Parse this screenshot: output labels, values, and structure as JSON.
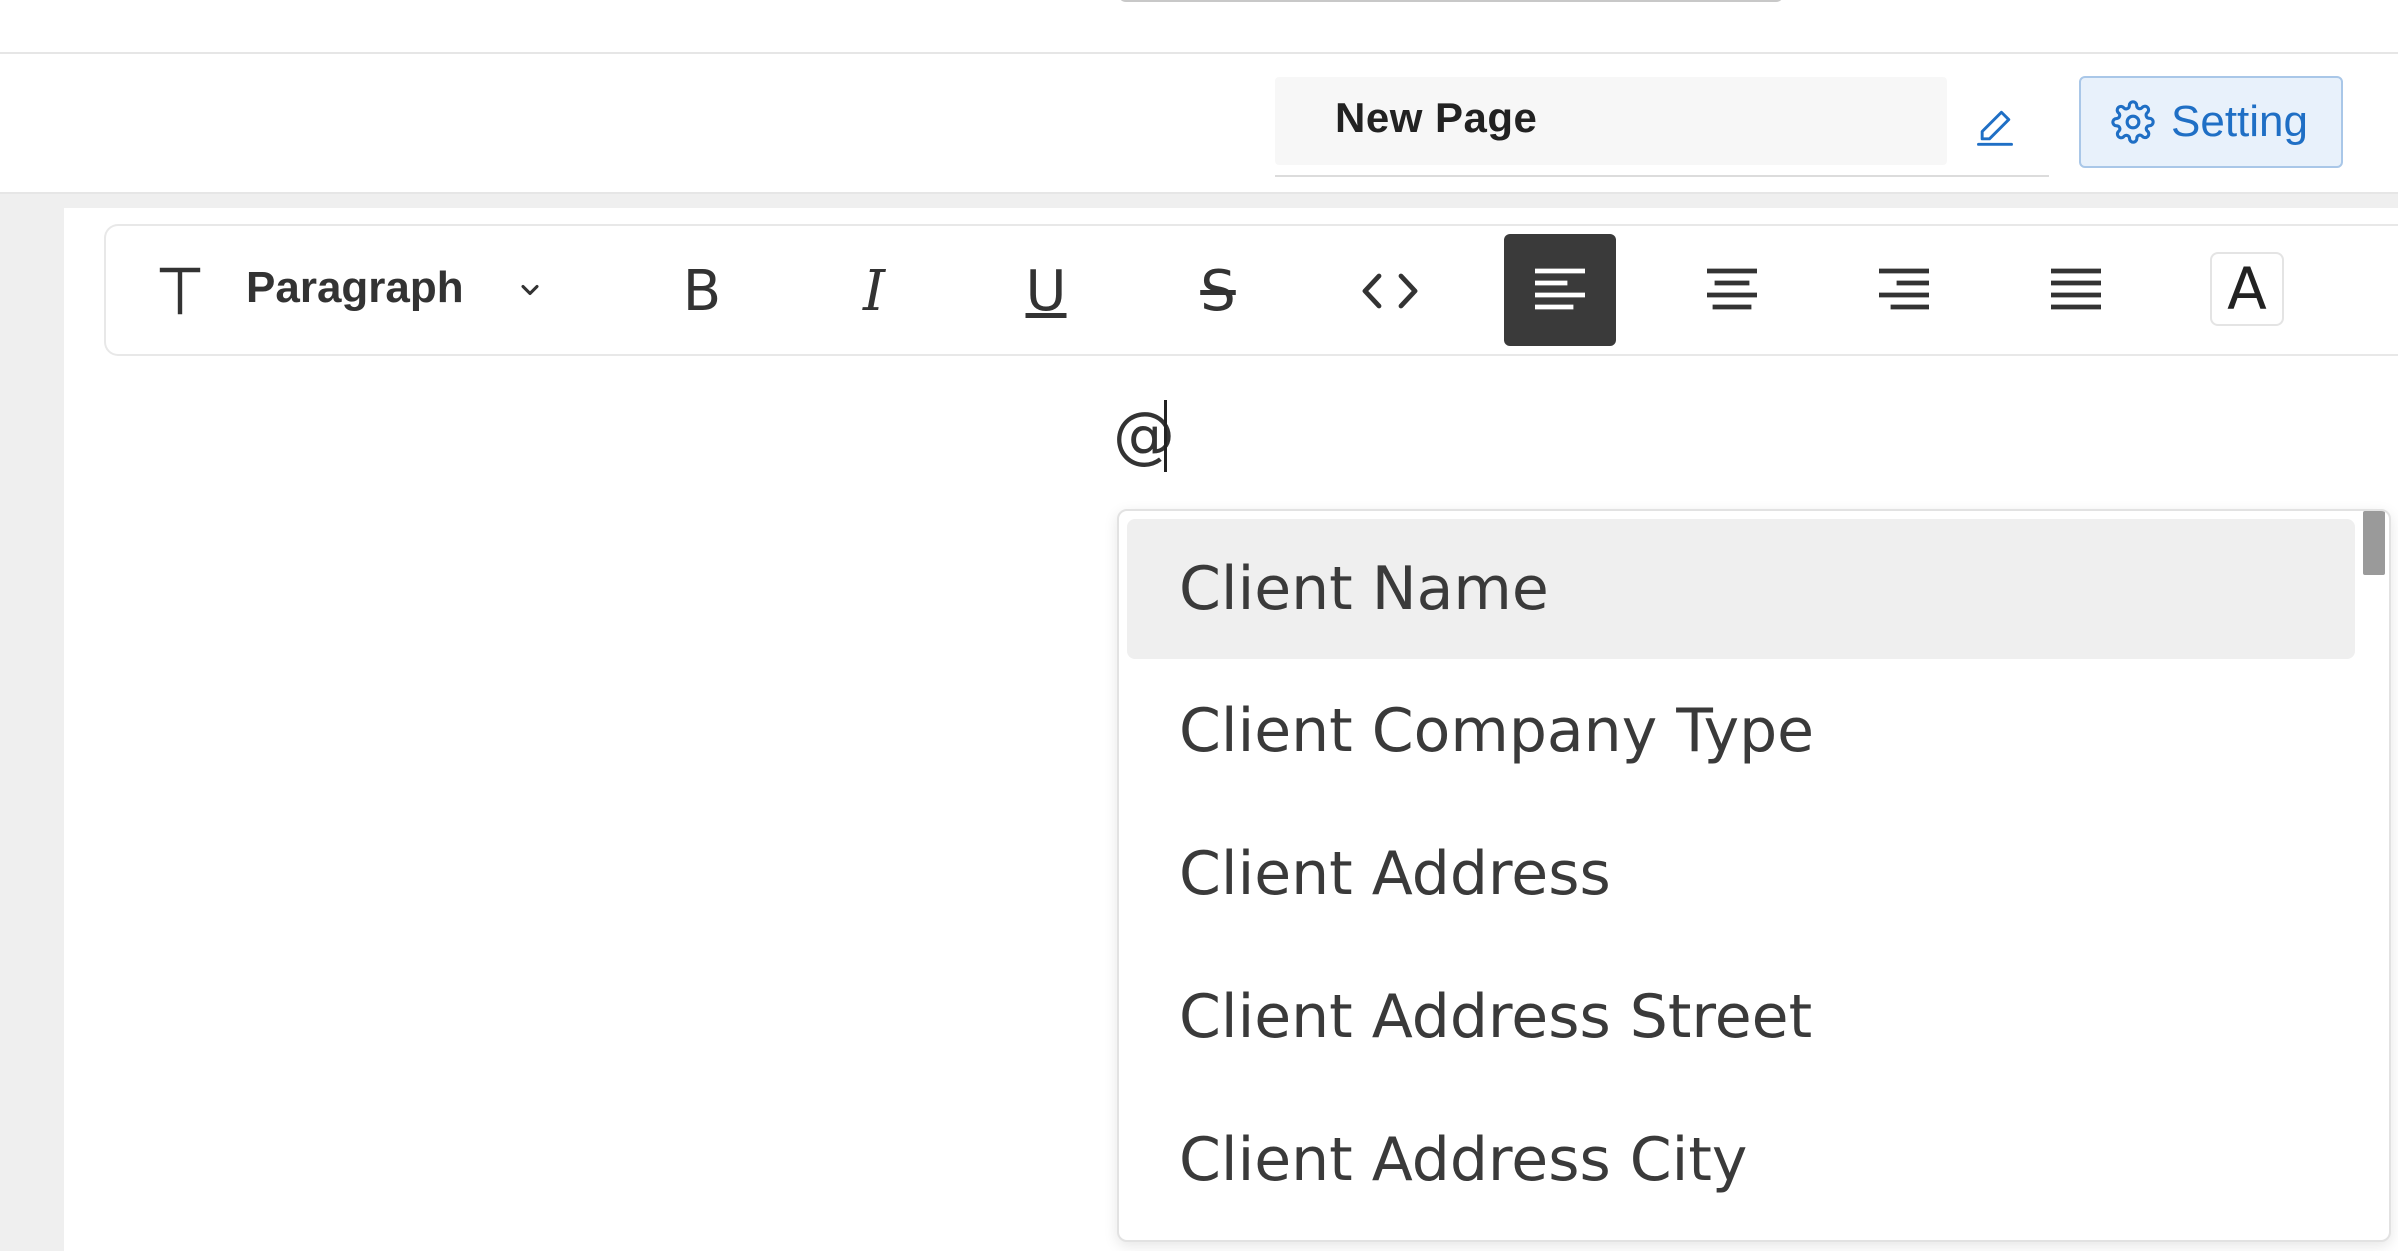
{
  "header": {
    "page_title": "New Page",
    "setting_label": "Setting",
    "colors": {
      "accent": "#1f6fc5",
      "setting_bg": "#e8f1fb"
    }
  },
  "toolbar": {
    "block_type_icon": "text-type-icon",
    "block_type_label": "Paragraph",
    "buttons": [
      {
        "name": "bold",
        "glyph": "B"
      },
      {
        "name": "italic",
        "glyph": "I"
      },
      {
        "name": "underline",
        "glyph": "U"
      },
      {
        "name": "strikethrough",
        "glyph": "S"
      },
      {
        "name": "code",
        "glyph": "<>"
      },
      {
        "name": "align-left",
        "glyph": "align-left-icon",
        "active": true
      },
      {
        "name": "align-center",
        "glyph": "align-center-icon"
      },
      {
        "name": "align-right",
        "glyph": "align-right-icon"
      },
      {
        "name": "align-justify",
        "glyph": "align-justify-icon"
      },
      {
        "name": "font-color",
        "glyph": "A"
      }
    ]
  },
  "editor": {
    "typed_text": "@"
  },
  "mention_menu": {
    "items": [
      {
        "label": "Client Name",
        "highlighted": true
      },
      {
        "label": "Client Company Type"
      },
      {
        "label": "Client Address"
      },
      {
        "label": "Client Address Street"
      },
      {
        "label": "Client Address City"
      }
    ]
  }
}
